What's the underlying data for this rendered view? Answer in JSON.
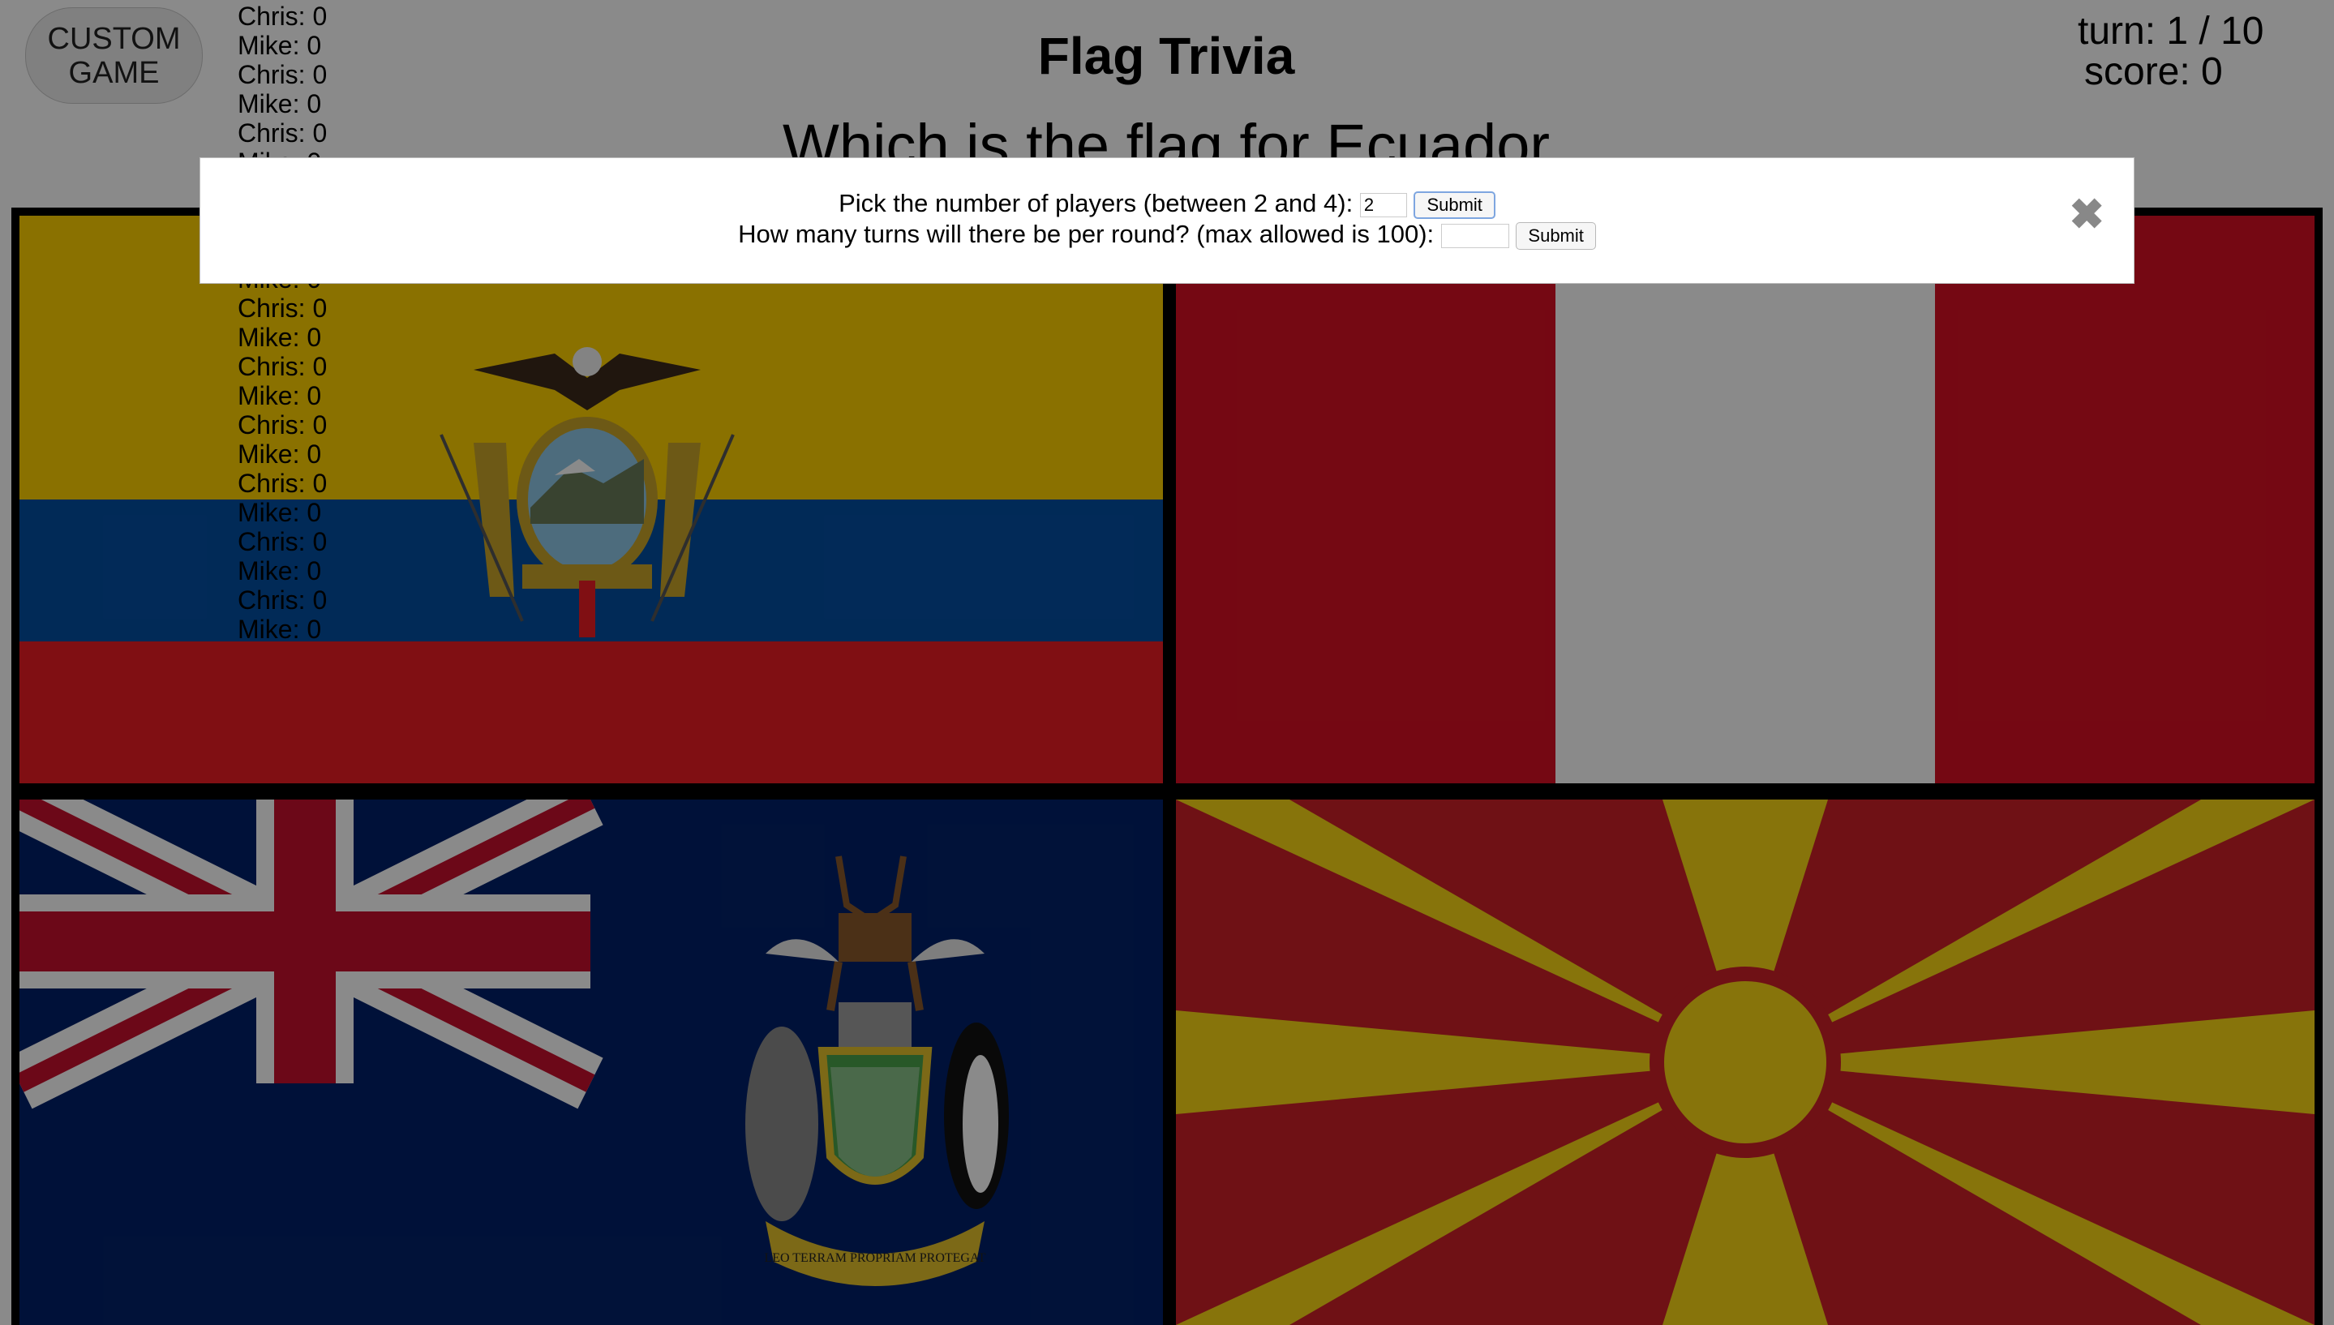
{
  "app": {
    "custom_game_line1": "CUSTOM",
    "custom_game_line2": "GAME",
    "title": "Flag Trivia",
    "question": "Which is the flag for Ecuador",
    "turn_text": "turn: 1 / 10",
    "score_text": "score: 0"
  },
  "scoreboard": [
    "Chris: 0",
    "Mike: 0",
    "Chris: 0",
    "Mike: 0",
    "Chris: 0",
    "Mike: 0",
    "Chris: 0",
    "Mike: 0",
    "Chris: 0",
    "Mike: 0",
    "Chris: 0",
    "Mike: 0",
    "Chris: 0",
    "Mike: 0",
    "Chris: 0",
    "Mike: 0",
    "Chris: 0",
    "Mike: 0",
    "Chris: 0",
    "Mike: 0",
    "Chris: 0",
    "Mike: 0"
  ],
  "modal": {
    "players_prompt": "Pick the number of players (between 2 and 4):",
    "players_value": "2",
    "turns_prompt": "How many turns will there be per round? (max allowed is 100):",
    "turns_value": "",
    "submit_label": "Submit",
    "close_symbol": "✖"
  },
  "flags": [
    {
      "country": "Ecuador",
      "icon": "ecuador-flag"
    },
    {
      "country": "Peru",
      "icon": "peru-flag"
    },
    {
      "country": "South Georgia and the South Sandwich Islands",
      "icon": "south-georgia-flag",
      "motto": "LEO TERRAM PROPRIAM PROTEGAT"
    },
    {
      "country": "North Macedonia",
      "icon": "north-macedonia-flag"
    }
  ],
  "colors": {
    "ecuador_yellow": "#FFD100",
    "ecuador_blue": "#034EA2",
    "ecuador_red": "#ED1C24",
    "peru_red": "#D91023",
    "sgssi_blue": "#012169",
    "macedonia_red": "#CE2028",
    "macedonia_yellow": "#F9D616"
  }
}
